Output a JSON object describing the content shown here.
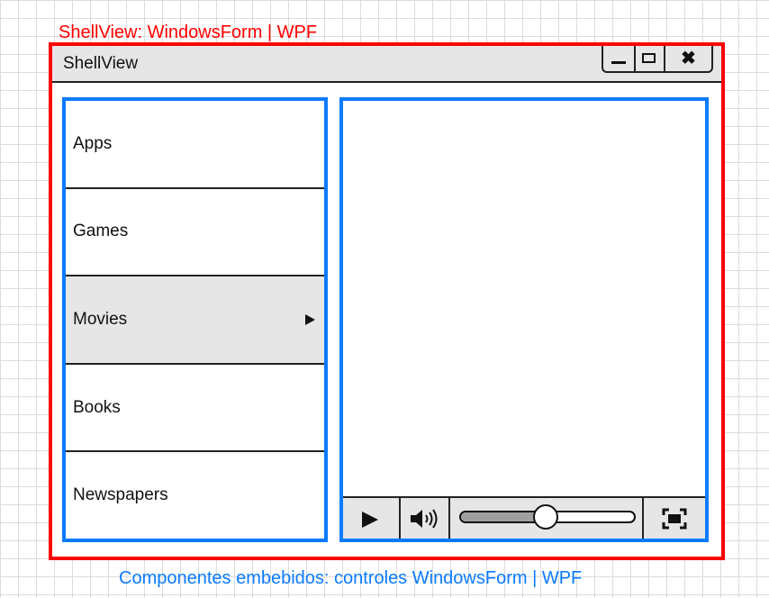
{
  "captions": {
    "top": "ShellView: WindowsForm | WPF",
    "bottom": "Componentes embebidos: controles WindowsForm | WPF"
  },
  "window": {
    "title": "ShellView",
    "controls": {
      "minimize_icon": "minimize-icon",
      "maximize_icon": "maximize-icon",
      "close_icon": "close-icon",
      "close_glyph": "✖"
    }
  },
  "nav": {
    "items": [
      {
        "label": "Apps",
        "selected": false
      },
      {
        "label": "Games",
        "selected": false
      },
      {
        "label": "Movies",
        "selected": true,
        "icon": "play-arrow-icon"
      },
      {
        "label": "Books",
        "selected": false
      },
      {
        "label": "Newspapers",
        "selected": false
      }
    ]
  },
  "player": {
    "play_icon": "play-icon",
    "volume_icon": "volume-icon",
    "fullscreen_icon": "fullscreen-icon",
    "seek_progress": 0.49
  },
  "colors": {
    "shell_frame": "#ff0000",
    "embedded_frame": "#0a7bff",
    "selected_item_bg": "#e6e6e6",
    "title_bar_bg": "#e6e6e6"
  }
}
